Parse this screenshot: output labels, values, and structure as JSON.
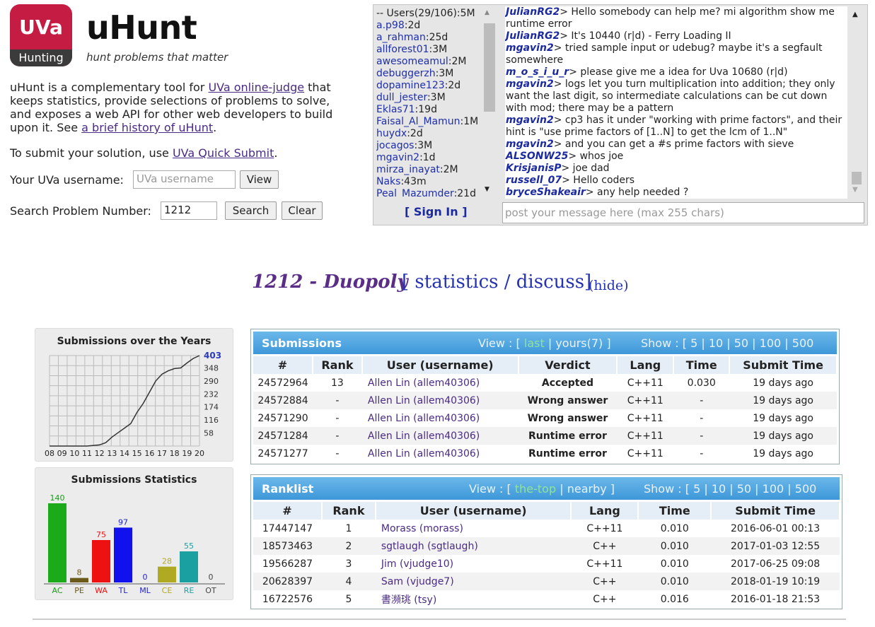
{
  "header": {
    "logo_top": "UVa",
    "logo_bottom": "Hunting",
    "brand": "uHunt",
    "tagline": "hunt problems that matter",
    "intro_pre": "uHunt is a complementary tool for ",
    "intro_link": "UVa online-judge",
    "intro_mid": " that keeps statistics, provide selections of problems to solve, and exposes a web API for other web developers to build upon it. See ",
    "history_link": "a brief history of uHunt",
    "intro_end": ".",
    "submit_pre": "To submit your solution, use ",
    "submit_link": "UVa Quick Submit",
    "submit_end": ".",
    "username_label": "Your UVa username:",
    "username_placeholder": "UVa username",
    "view_button": "View",
    "search_label": "Search Problem Number:",
    "search_value": "1212",
    "search_button": "Search",
    "clear_button": "Clear"
  },
  "chat": {
    "users_header": "-- Users(29/106):5M",
    "users": [
      {
        "name": "a.p98",
        "time": "2d"
      },
      {
        "name": "a_rahman",
        "time": "25d"
      },
      {
        "name": "allforest01",
        "time": "3M"
      },
      {
        "name": "awesomeamul",
        "time": "2M"
      },
      {
        "name": "debuggerzh",
        "time": "3M"
      },
      {
        "name": "dopamine123",
        "time": "2d"
      },
      {
        "name": "dull_jester",
        "time": "3M"
      },
      {
        "name": "Eklas71",
        "time": "19d"
      },
      {
        "name": "Faisal_Al_Mamun",
        "time": "1M"
      },
      {
        "name": "huydx",
        "time": "2d"
      },
      {
        "name": "jocagos",
        "time": "3M"
      },
      {
        "name": "mgavin2",
        "time": "1d"
      },
      {
        "name": "mirza_inayat",
        "time": "2M"
      },
      {
        "name": "Naks",
        "time": "43m"
      },
      {
        "name": "Peal_Mazumder",
        "time": "21d"
      }
    ],
    "messages": [
      {
        "who": "JulianRG2",
        "text": "> Hello somebody can help me? mi algorithm show me runtime error"
      },
      {
        "who": "JulianRG2",
        "text": "> It's 10440 (r|d) - Ferry Loading II"
      },
      {
        "who": "mgavin2",
        "text": "> tried sample input or udebug? maybe it's a segfault somewhere"
      },
      {
        "who": "m_o_s_i_u_r",
        "text": "> please give me a idea for Uva 10680 (r|d)"
      },
      {
        "who": "mgavin2",
        "text": "> logs let you turn multiplication into addition; they only want the last digit, so intermediate calculations can be cut down with mod; there may be a pattern"
      },
      {
        "who": "mgavin2",
        "text": "> cp3 has it under \"working with prime factors\", and their hint is \"use prime factors of [1..N] to get the lcm of 1..N\""
      },
      {
        "who": "mgavin2",
        "text": "> and you can get a #s prime factors with sieve"
      },
      {
        "who": "ALSONW25",
        "text": "> whos joe"
      },
      {
        "who": "KrisjanisP",
        "text": "> joe dad"
      },
      {
        "who": "russell_07",
        "text": "> Hello coders"
      },
      {
        "who": "bryceShakeair",
        "text": "> any help needed ?"
      }
    ],
    "sign_in": "[ Sign In ]",
    "post_placeholder": "post your message here (max 255 chars)"
  },
  "problem": {
    "title": "1212 - Duopoly",
    "links": "[ statistics / discuss]",
    "hide": "(hide)"
  },
  "charts": {
    "colors": {
      "line": "#333333",
      "grid": "#bbbbbb"
    },
    "years": {
      "title": "Submissions over the Years",
      "x_labels": [
        "08",
        "09",
        "10",
        "11",
        "12",
        "13",
        "14",
        "15",
        "16",
        "17",
        "18",
        "19",
        "20"
      ],
      "y_labels": [
        "403",
        "348",
        "290",
        "232",
        "174",
        "116",
        "58"
      ],
      "top_label_color": "#2b3bbb"
    },
    "stats": {
      "title": "Submissions Statistics"
    }
  },
  "chart_data": [
    {
      "type": "line",
      "title": "Submissions over the Years",
      "x": [
        2008,
        2009,
        2010,
        2011,
        2012,
        2012.5,
        2013,
        2013.5,
        2014,
        2014.5,
        2015,
        2015.5,
        2016,
        2016.5,
        2017,
        2017.5,
        2018,
        2018.5,
        2019,
        2019.5,
        2020
      ],
      "y": [
        0,
        0,
        0,
        0,
        5,
        15,
        40,
        60,
        80,
        100,
        150,
        190,
        240,
        290,
        320,
        335,
        345,
        348,
        370,
        390,
        403
      ],
      "ylim": [
        0,
        403
      ],
      "x_tick_labels": [
        "08",
        "09",
        "10",
        "11",
        "12",
        "13",
        "14",
        "15",
        "16",
        "17",
        "18",
        "19",
        "20"
      ],
      "y_tick_labels": [
        "58",
        "116",
        "174",
        "232",
        "290",
        "348",
        "403"
      ],
      "grid": true
    },
    {
      "type": "bar",
      "title": "Submissions Statistics",
      "categories": [
        "AC",
        "PE",
        "WA",
        "TL",
        "ML",
        "CE",
        "RE",
        "OT"
      ],
      "values": [
        140,
        8,
        75,
        97,
        0,
        28,
        55,
        0
      ],
      "colors": [
        "#1aaa1a",
        "#6b5a1a",
        "#ee1111",
        "#1111ee",
        "#1a1aaa",
        "#b0aa22",
        "#1aa0a0",
        "#222222"
      ],
      "label_colors": [
        "#1a9a1a",
        "#6b5a1a",
        "#ee1111",
        "#2222cc",
        "#2222cc",
        "#b0aa22",
        "#1aa0a0",
        "#444444"
      ]
    }
  ],
  "submissions": {
    "title": "Submissions",
    "view_label": "View : [",
    "view_last": "last",
    "view_sep": "|",
    "view_yours": "yours(7)",
    "view_end": "]",
    "show_label": "Show : [",
    "show_opts": [
      "5",
      "10",
      "50",
      "100",
      "500"
    ],
    "columns": [
      "#",
      "Rank",
      "User (username)",
      "Verdict",
      "Lang",
      "Time",
      "Submit Time"
    ],
    "rows": [
      {
        "id": "24572964",
        "rank": "13",
        "user": "Allen Lin (allem40306)",
        "verdict": "Accepted",
        "vclass": "v-ac",
        "lang": "C++11",
        "time": "0.030",
        "submit": "19 days ago"
      },
      {
        "id": "24572884",
        "rank": "-",
        "user": "Allen Lin (allem40306)",
        "verdict": "Wrong answer",
        "vclass": "v-wa",
        "lang": "C++11",
        "time": "-",
        "submit": "19 days ago"
      },
      {
        "id": "24571290",
        "rank": "-",
        "user": "Allen Lin (allem40306)",
        "verdict": "Wrong answer",
        "vclass": "v-wa",
        "lang": "C++11",
        "time": "-",
        "submit": "19 days ago"
      },
      {
        "id": "24571284",
        "rank": "-",
        "user": "Allen Lin (allem40306)",
        "verdict": "Runtime error",
        "vclass": "v-re",
        "lang": "C++11",
        "time": "-",
        "submit": "19 days ago"
      },
      {
        "id": "24571277",
        "rank": "-",
        "user": "Allen Lin (allem40306)",
        "verdict": "Runtime error",
        "vclass": "v-re",
        "lang": "C++11",
        "time": "-",
        "submit": "19 days ago"
      }
    ]
  },
  "ranklist": {
    "title": "Ranklist",
    "view_label": "View : [",
    "view_top": "the-top",
    "view_sep": "|",
    "view_nearby": "nearby",
    "view_end": "]",
    "show_label": "Show : [",
    "show_opts": [
      "5",
      "10",
      "50",
      "100",
      "500"
    ],
    "columns": [
      "#",
      "Rank",
      "User (username)",
      "Lang",
      "Time",
      "Submit Time"
    ],
    "rows": [
      {
        "id": "17447147",
        "rank": "1",
        "user": "Morass (morass)",
        "lang": "C++11",
        "time": "0.010",
        "submit": "2016-06-01 00:13"
      },
      {
        "id": "18573463",
        "rank": "2",
        "user": "sgtlaugh (sgtlaugh)",
        "lang": "C++",
        "time": "0.010",
        "submit": "2017-01-03 12:55"
      },
      {
        "id": "19566287",
        "rank": "3",
        "user": "Jim (vjudge10)",
        "lang": "C++11",
        "time": "0.010",
        "submit": "2017-06-25 09:08"
      },
      {
        "id": "20628397",
        "rank": "4",
        "user": "Sam (vjudge7)",
        "lang": "C++",
        "time": "0.010",
        "submit": "2018-01-19 10:19"
      },
      {
        "id": "16722576",
        "rank": "5",
        "user": "書瀕珧 (tsy)",
        "lang": "C++",
        "time": "0.016",
        "submit": "2016-01-18 21:53"
      }
    ]
  }
}
